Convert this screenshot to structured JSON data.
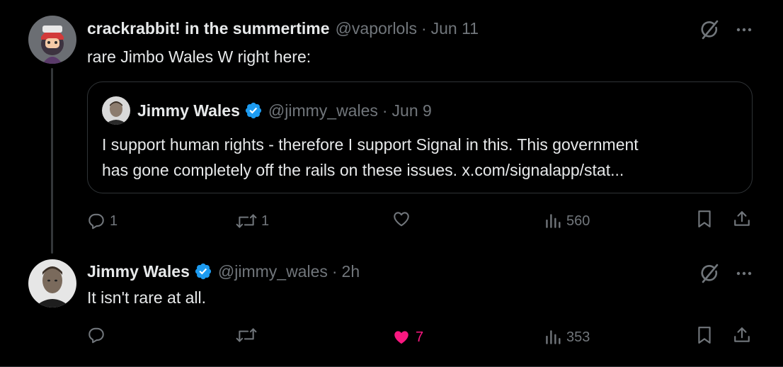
{
  "colors": {
    "background": "#000000",
    "text": "#e7e9ea",
    "muted": "#71767b",
    "border": "#2f3336",
    "verified": "#1d9bf0",
    "like_active": "#f91880"
  },
  "tweet1": {
    "author_name": "crackrabbit! in the summertime",
    "handle": "@vaporlols",
    "separator": "·",
    "time": "Jun 11",
    "text": "rare Jimbo Wales W right here:",
    "quote": {
      "author_name": "Jimmy Wales",
      "handle": "@jimmy_wales",
      "separator": "·",
      "time": "Jun 9",
      "text_line1": "I support human rights - therefore I support Signal in this.  This government",
      "text_line2": "has gone completely off the rails on these issues. x.com/signalapp/stat..."
    },
    "actions": {
      "reply_count": "1",
      "retweet_count": "1",
      "like_count": "",
      "views_count": "560"
    }
  },
  "tweet2": {
    "author_name": "Jimmy Wales",
    "handle": "@jimmy_wales",
    "separator": "·",
    "time": "2h",
    "text": "It isn't rare at all.",
    "actions": {
      "reply_count": "",
      "retweet_count": "",
      "like_count": "7",
      "like_active": true,
      "views_count": "353"
    }
  },
  "icons": {
    "reply": "reply-icon",
    "retweet": "retweet-icon",
    "like": "heart-icon",
    "views": "analytics-icon",
    "bookmark": "bookmark-icon",
    "share": "share-icon",
    "grok": "grok-icon",
    "more": "more-icon",
    "verified": "verified-badge-icon"
  }
}
